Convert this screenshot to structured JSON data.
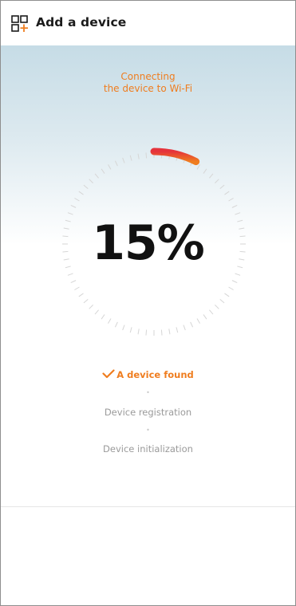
{
  "header": {
    "title": "Add a device",
    "icon": "add-device-grid-icon"
  },
  "status": {
    "line1": "Connecting",
    "line2": "the device to Wi-Fi"
  },
  "progress": {
    "percent_label": "15%",
    "value": 0.15
  },
  "steps": [
    {
      "label": "A device found",
      "state": "done"
    },
    {
      "label": "Device registration",
      "state": "pending"
    },
    {
      "label": "Device initialization",
      "state": "pending"
    }
  ],
  "colors": {
    "accent": "#ef7d1f",
    "accent_start": "#e5333b",
    "hero_top": "#c6dce6",
    "muted_text": "#9a9a9a"
  }
}
